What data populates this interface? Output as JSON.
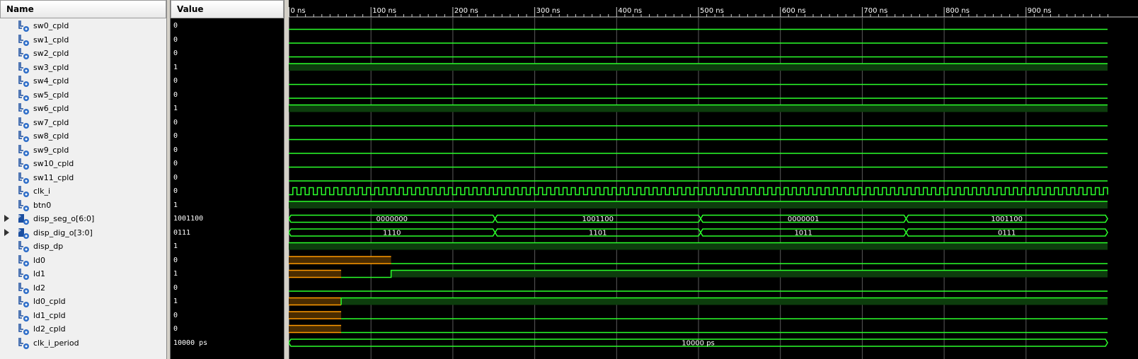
{
  "columns": {
    "name": "Name",
    "value": "Value"
  },
  "colors": {
    "wave": "#2bff2b",
    "wave_dim": "#0d3d0d",
    "bus_text": "#ffffff",
    "undefined": "#ff9a00",
    "undefined_fill": "#4a2c00",
    "grid": "#5a5a5a",
    "ruler": "#cccccc",
    "ruler_text": "#ffffff"
  },
  "timeline": {
    "unit": "ns",
    "start": 0,
    "end": 1000,
    "major_ticks": [
      0,
      100,
      200,
      300,
      400,
      500,
      600,
      700,
      800,
      900
    ],
    "tick_labels": [
      "0 ns",
      "100 ns",
      "200 ns",
      "300 ns",
      "400 ns",
      "500 ns",
      "600 ns",
      "700 ns",
      "800 ns",
      "900 ns"
    ]
  },
  "signals": [
    {
      "name": "sw0_cpld",
      "value": "0",
      "icon": "bit-signal-icon",
      "type": "bit",
      "segments": [
        {
          "t0": 0,
          "t1": 1000,
          "v": "0"
        }
      ]
    },
    {
      "name": "sw1_cpld",
      "value": "0",
      "icon": "bit-signal-icon",
      "type": "bit",
      "segments": [
        {
          "t0": 0,
          "t1": 1000,
          "v": "0"
        }
      ]
    },
    {
      "name": "sw2_cpld",
      "value": "0",
      "icon": "bit-signal-icon",
      "type": "bit",
      "segments": [
        {
          "t0": 0,
          "t1": 1000,
          "v": "0"
        }
      ]
    },
    {
      "name": "sw3_cpld",
      "value": "1",
      "icon": "bit-signal-icon",
      "type": "bit",
      "segments": [
        {
          "t0": 0,
          "t1": 1000,
          "v": "1"
        }
      ]
    },
    {
      "name": "sw4_cpld",
      "value": "0",
      "icon": "bit-signal-icon",
      "type": "bit",
      "segments": [
        {
          "t0": 0,
          "t1": 1000,
          "v": "0"
        }
      ]
    },
    {
      "name": "sw5_cpld",
      "value": "0",
      "icon": "bit-signal-icon",
      "type": "bit",
      "segments": [
        {
          "t0": 0,
          "t1": 1000,
          "v": "0"
        }
      ]
    },
    {
      "name": "sw6_cpld",
      "value": "1",
      "icon": "bit-signal-icon",
      "type": "bit",
      "segments": [
        {
          "t0": 0,
          "t1": 1000,
          "v": "1"
        }
      ]
    },
    {
      "name": "sw7_cpld",
      "value": "0",
      "icon": "bit-signal-icon",
      "type": "bit",
      "segments": [
        {
          "t0": 0,
          "t1": 1000,
          "v": "0"
        }
      ]
    },
    {
      "name": "sw8_cpld",
      "value": "0",
      "icon": "bit-signal-icon",
      "type": "bit",
      "segments": [
        {
          "t0": 0,
          "t1": 1000,
          "v": "0"
        }
      ]
    },
    {
      "name": "sw9_cpld",
      "value": "0",
      "icon": "bit-signal-icon",
      "type": "bit",
      "segments": [
        {
          "t0": 0,
          "t1": 1000,
          "v": "0"
        }
      ]
    },
    {
      "name": "sw10_cpld",
      "value": "0",
      "icon": "bit-signal-icon",
      "type": "bit",
      "segments": [
        {
          "t0": 0,
          "t1": 1000,
          "v": "0"
        }
      ]
    },
    {
      "name": "sw11_cpld",
      "value": "0",
      "icon": "bit-signal-icon",
      "type": "bit",
      "segments": [
        {
          "t0": 0,
          "t1": 1000,
          "v": "0"
        }
      ]
    },
    {
      "name": "clk_i",
      "value": "0",
      "icon": "bit-signal-icon",
      "type": "clock",
      "clock_period": 10
    },
    {
      "name": "btn0",
      "value": "1",
      "icon": "bit-signal-icon",
      "type": "bit",
      "segments": [
        {
          "t0": 0,
          "t1": 1000,
          "v": "1"
        }
      ]
    },
    {
      "name": "disp_seg_o[6:0]",
      "value": "1001100",
      "icon": "bus-signal-icon",
      "type": "bus",
      "expandable": true,
      "segments": [
        {
          "t0": 0,
          "t1": 252,
          "v": "0000000"
        },
        {
          "t0": 252,
          "t1": 503,
          "v": "1001100"
        },
        {
          "t0": 503,
          "t1": 754,
          "v": "0000001"
        },
        {
          "t0": 754,
          "t1": 1000,
          "v": "1001100"
        }
      ]
    },
    {
      "name": "disp_dig_o[3:0]",
      "value": "0111",
      "icon": "bus-signal-icon",
      "type": "bus",
      "expandable": true,
      "segments": [
        {
          "t0": 0,
          "t1": 252,
          "v": "1110"
        },
        {
          "t0": 252,
          "t1": 503,
          "v": "1101"
        },
        {
          "t0": 503,
          "t1": 754,
          "v": "1011"
        },
        {
          "t0": 754,
          "t1": 1000,
          "v": "0111"
        }
      ]
    },
    {
      "name": "disp_dp",
      "value": "1",
      "icon": "bit-signal-icon",
      "type": "bit",
      "segments": [
        {
          "t0": 0,
          "t1": 1000,
          "v": "1"
        }
      ]
    },
    {
      "name": "ld0",
      "value": "0",
      "icon": "bit-signal-icon",
      "type": "bit",
      "segments": [
        {
          "t0": 0,
          "t1": 125,
          "v": "X"
        },
        {
          "t0": 125,
          "t1": 1000,
          "v": "0"
        }
      ]
    },
    {
      "name": "ld1",
      "value": "1",
      "icon": "bit-signal-icon",
      "type": "bit",
      "segments": [
        {
          "t0": 0,
          "t1": 64,
          "v": "X"
        },
        {
          "t0": 64,
          "t1": 125,
          "v": "0"
        },
        {
          "t0": 125,
          "t1": 1000,
          "v": "1"
        }
      ]
    },
    {
      "name": "ld2",
      "value": "0",
      "icon": "bit-signal-icon",
      "type": "bit",
      "segments": [
        {
          "t0": 0,
          "t1": 1000,
          "v": "0"
        }
      ]
    },
    {
      "name": "ld0_cpld",
      "value": "1",
      "icon": "bit-signal-icon",
      "type": "bit",
      "segments": [
        {
          "t0": 0,
          "t1": 64,
          "v": "X"
        },
        {
          "t0": 64,
          "t1": 1000,
          "v": "1"
        }
      ]
    },
    {
      "name": "ld1_cpld",
      "value": "0",
      "icon": "bit-signal-icon",
      "type": "bit",
      "segments": [
        {
          "t0": 0,
          "t1": 64,
          "v": "X"
        },
        {
          "t0": 64,
          "t1": 1000,
          "v": "0"
        }
      ]
    },
    {
      "name": "ld2_cpld",
      "value": "0",
      "icon": "bit-signal-icon",
      "type": "bit",
      "segments": [
        {
          "t0": 0,
          "t1": 64,
          "v": "X"
        },
        {
          "t0": 64,
          "t1": 1000,
          "v": "0"
        }
      ]
    },
    {
      "name": "clk_i_period",
      "value": "10000 ps",
      "icon": "bit-signal-icon",
      "type": "bus",
      "segments": [
        {
          "t0": 0,
          "t1": 1000,
          "v": "10000 ps"
        }
      ]
    }
  ]
}
